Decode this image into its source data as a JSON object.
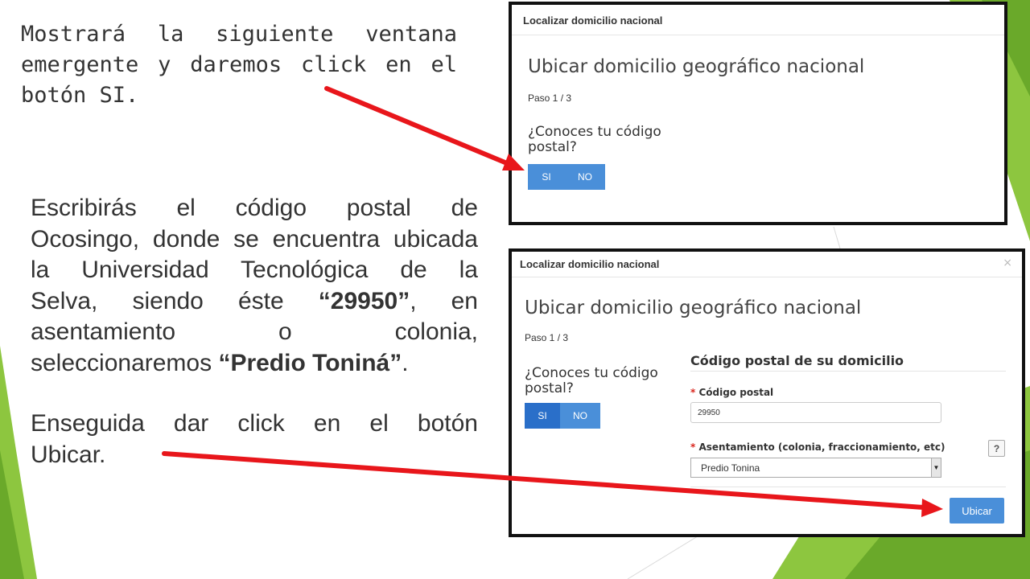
{
  "colors": {
    "accent": "#4a8fd9",
    "arrow": "#e8161b",
    "green": "#8dc63f",
    "required": "#d9251c"
  },
  "instructions": {
    "p1_lines": [
      "Mostrará la siguiente ventana",
      "emergente y daremos click en el",
      "botón SI."
    ],
    "p2": {
      "l1": "Escribirás el código postal de",
      "l2": "Ocosingo, donde se encuentra ubicada",
      "l3": "la Universidad Tecnológica de la",
      "l4_pre": "Selva, siendo éste ",
      "l4_bold": "“29950”",
      "l4_post": ", en",
      "l5": "asentamiento o colonia,",
      "l6_pre": "seleccionaremos ",
      "l6_bold": "“Predio Toniná”",
      "l6_post": "."
    },
    "p3_lines": [
      "Enseguida dar click en el botón",
      "Ubicar."
    ]
  },
  "modal1": {
    "header_title": "Localizar domicilio nacional",
    "heading": "Ubicar domicilio geográfico nacional",
    "step": "Paso 1 / 3",
    "question": "¿Conoces tu código postal?",
    "btn_si": "SI",
    "btn_no": "NO"
  },
  "modal2": {
    "header_title": "Localizar domicilio nacional",
    "close_glyph": "×",
    "heading": "Ubicar domicilio geográfico nacional",
    "step": "Paso 1 / 3",
    "question": "¿Conoces tu código postal?",
    "btn_si": "SI",
    "btn_no": "NO",
    "form_title": "Código postal de su domicilio",
    "required_mark": "*",
    "cp_label": "Código postal",
    "cp_value": "29950",
    "asent_label": "Asentamiento (colonia, fraccionamiento, etc)",
    "asent_value": "Predio Tonina",
    "help_glyph": "?",
    "ubicar_label": "Ubicar"
  }
}
